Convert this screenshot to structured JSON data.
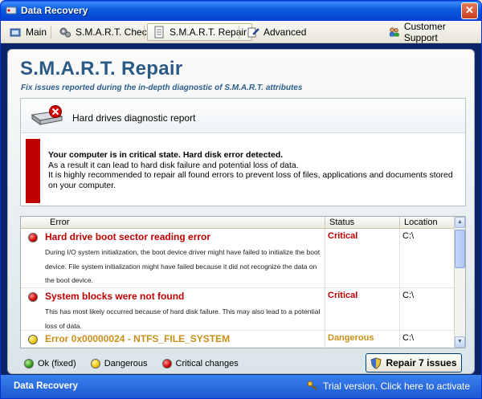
{
  "window": {
    "title": "Data Recovery",
    "close": "✕"
  },
  "toolbar": {
    "items": [
      {
        "label": "Main"
      },
      {
        "label": "S.M.A.R.T. Check"
      },
      {
        "label": "S.M.A.R.T. Repair"
      },
      {
        "label": "Advanced"
      }
    ],
    "support": "Customer Support"
  },
  "page": {
    "title": "S.M.A.R.T. Repair",
    "subtitle": "Fix issues reported during the in-depth diagnostic of S.M.A.R.T. attributes"
  },
  "report": {
    "title": "Hard drives diagnostic report",
    "alert_bold": "Your computer is in critical state. Hard disk error detected.",
    "alert_line2": "As a result it can lead to hard disk failure and potential loss of data.",
    "alert_line3": "It is highly recommended to repair all found errors to prevent loss of files, applications and documents stored on your computer."
  },
  "table": {
    "columns": [
      "Error",
      "Status",
      "Location"
    ],
    "rows": [
      {
        "title": "Hard drive boot sector reading error",
        "description": "During I/O system initialization, the boot device driver might have failed to initialize the boot device. File system initialization might have failed because it did not recognize the data on the boot device.",
        "status": "Critical",
        "location": "C:\\",
        "level": "critical"
      },
      {
        "title": "System blocks were not found",
        "description": "This has most likely occurred because of hard disk failure. This may also lead to a potential loss of data.",
        "status": "Critical",
        "location": "C:\\",
        "level": "critical"
      },
      {
        "title": "Error 0x00000024 - NTFS_FILE_SYSTEM",
        "description": "",
        "status": "Dangerous",
        "location": "C:\\",
        "level": "dangerous"
      }
    ]
  },
  "legend": {
    "ok": "Ok (fixed)",
    "dangerous": "Dangerous",
    "critical": "Critical changes"
  },
  "repair_button": "Repair 7 issues",
  "statusbar": {
    "left": "Data Recovery",
    "right": "Trial version. Click here to activate"
  },
  "colors": {
    "critical": "#c00000",
    "dangerous": "#c8901a",
    "title": "#2b5a87",
    "statusbar": "#2a6ae0"
  }
}
